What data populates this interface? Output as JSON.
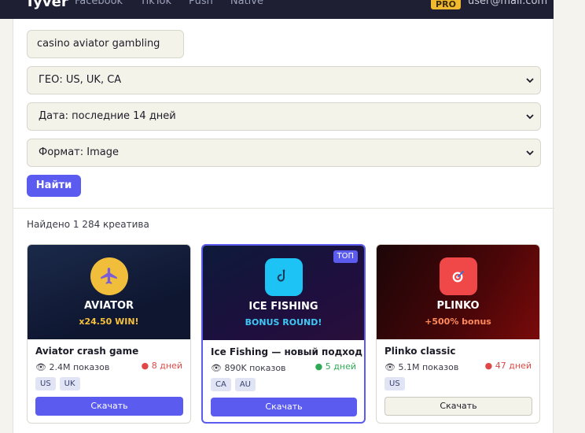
{
  "topbar": {
    "brand": "Tyver",
    "nav": [
      "Facebook",
      "TikTok",
      "Push",
      "Native"
    ],
    "pro_label": "PRO",
    "user_email": "user@mail.com"
  },
  "search": {
    "query": "casino aviator gambling",
    "geo": "ГЕО: US, UK, CA",
    "date": "Дата: последние 14 дней",
    "format": "Формат: Image",
    "submit_label": "Найти"
  },
  "results": {
    "count_label": "Найдено 1 284 креатива",
    "cards": [
      {
        "thumb_title": "AVIATOR",
        "thumb_subtitle": "x24.50 WIN!",
        "icon": "airplane-icon",
        "title": "Aviator crash game",
        "views": "2.4M показов",
        "age": "8 дней",
        "age_color": "#e04848",
        "tags": [
          "US",
          "UK"
        ],
        "download_label": "Скачать",
        "badge": ""
      },
      {
        "thumb_title": "ICE FISHING",
        "thumb_subtitle": "BONUS ROUND!",
        "icon": "fishing-hook-icon",
        "title": "Ice Fishing — новый подход",
        "views": "890K показов",
        "age": "5 дней",
        "age_color": "#2eaa55",
        "tags": [
          "CA",
          "AU"
        ],
        "download_label": "Скачать",
        "badge": "ТОП"
      },
      {
        "thumb_title": "PLINKO",
        "thumb_subtitle": "+500% bonus",
        "icon": "target-icon",
        "title": "Plinko classic",
        "views": "5.1M показов",
        "age": "47 дней",
        "age_color": "#e04848",
        "tags": [
          "US"
        ],
        "download_label": "Скачать",
        "badge": ""
      }
    ]
  },
  "colors": {
    "accent": "#5b5bf0",
    "pro": "#f1b92d",
    "aviator_subtitle": "#f5c13a",
    "ice_subtitle": "#3ec8f5",
    "plinko_subtitle": "#ff8a5c"
  }
}
